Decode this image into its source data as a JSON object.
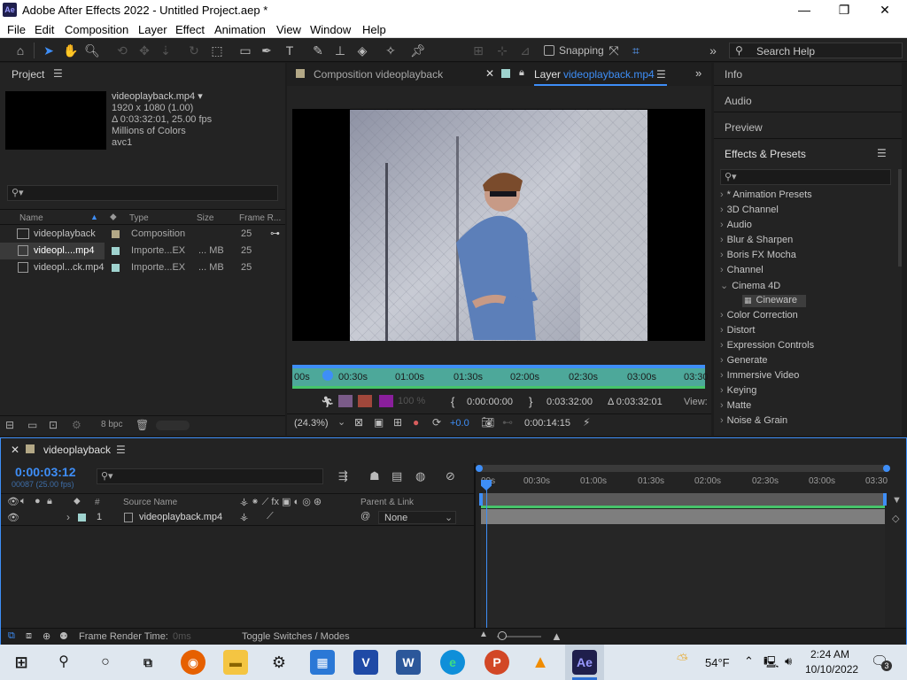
{
  "titlebar": {
    "logo": "Ae",
    "title": "Adobe After Effects 2022 - Untitled Project.aep *",
    "minimize": "—",
    "maximize": "❐",
    "close": "✕"
  },
  "menu": [
    "File",
    "Edit",
    "Composition",
    "Layer",
    "Effect",
    "Animation",
    "View",
    "Window",
    "Help"
  ],
  "toolbar": {
    "snapping_label": "Snapping",
    "search_placeholder": "Search Help"
  },
  "project": {
    "title": "Project",
    "file_name": "videoplayback.mp4 ▾",
    "file_info": [
      "1920 x 1080 (1.00)",
      "Δ 0:03:32:01, 25.00 fps",
      "Millions of Colors",
      "avc1"
    ],
    "columns": {
      "name": "Name",
      "type": "Type",
      "size": "Size",
      "frame_rate": "Frame R..."
    },
    "rows": [
      {
        "name": "videoplayback",
        "type": "Composition",
        "size": "",
        "fps": "25",
        "color": "#b3a886"
      },
      {
        "name": "videopl....mp4",
        "type": "Importe...EX",
        "size": "... MB",
        "fps": "25",
        "color": "#9fd3cf"
      },
      {
        "name": "videopl...ck.mp4",
        "type": "Importe...EX",
        "size": "... MB",
        "fps": "25",
        "color": "#9fd3cf"
      }
    ],
    "bpc": "8 bpc"
  },
  "viewer": {
    "tab_comp": "Composition videoplayback",
    "tab_layer_prefix": "Layer",
    "tab_layer_name": "videoplayback.mp4",
    "ruler_labels": [
      "00s",
      "00:30s",
      "01:00s",
      "01:30s",
      "02:00s",
      "02:30s",
      "03:00s",
      "03:30"
    ],
    "time_in": "0:00:00:00",
    "time_out": "0:03:32:00",
    "duration": "Δ 0:03:32:01",
    "view_label": "View:",
    "zoom": "(24.3%)",
    "exposure": "+0.0",
    "current_time": "0:00:14:15",
    "zoom_arrow": "⌄"
  },
  "right_panels": {
    "info": "Info",
    "audio": "Audio",
    "preview": "Preview",
    "effects_title": "Effects & Presets",
    "effects": [
      {
        "label": "* Animation Presets",
        "open": false
      },
      {
        "label": "3D Channel",
        "open": false
      },
      {
        "label": "Audio",
        "open": false
      },
      {
        "label": "Blur & Sharpen",
        "open": false
      },
      {
        "label": "Boris FX Mocha",
        "open": false
      },
      {
        "label": "Channel",
        "open": false
      },
      {
        "label": "Cinema 4D",
        "open": true
      },
      {
        "label": "Cineware",
        "child": true
      },
      {
        "label": "Color Correction",
        "open": false
      },
      {
        "label": "Distort",
        "open": false
      },
      {
        "label": "Expression Controls",
        "open": false
      },
      {
        "label": "Generate",
        "open": false
      },
      {
        "label": "Immersive Video",
        "open": false
      },
      {
        "label": "Keying",
        "open": false
      },
      {
        "label": "Matte",
        "open": false
      },
      {
        "label": "Noise & Grain",
        "open": false
      }
    ]
  },
  "timeline": {
    "comp_name": "videoplayback",
    "timecode": "0:00:03:12",
    "frames": "00087 (25.00 fps)",
    "ruler_labels": [
      "00s",
      "00:30s",
      "01:00s",
      "01:30s",
      "02:00s",
      "02:30s",
      "03:00s",
      "03:30"
    ],
    "col_source": "Source Name",
    "col_parent": "Parent & Link",
    "layer": {
      "index": "1",
      "name": "videoplayback.mp4",
      "parent": "None"
    },
    "footer_render": "Frame Render Time:",
    "footer_render_value": "0ms",
    "footer_toggle": "Toggle Switches / Modes"
  },
  "taskbar": {
    "weather": "54°F",
    "time": "2:24 AM",
    "date": "10/10/2022",
    "notif": "3"
  },
  "colors": {
    "accent": "#2d8ceb",
    "ae_purple": "#9999ff",
    "timeline_green": "#46c46a"
  }
}
